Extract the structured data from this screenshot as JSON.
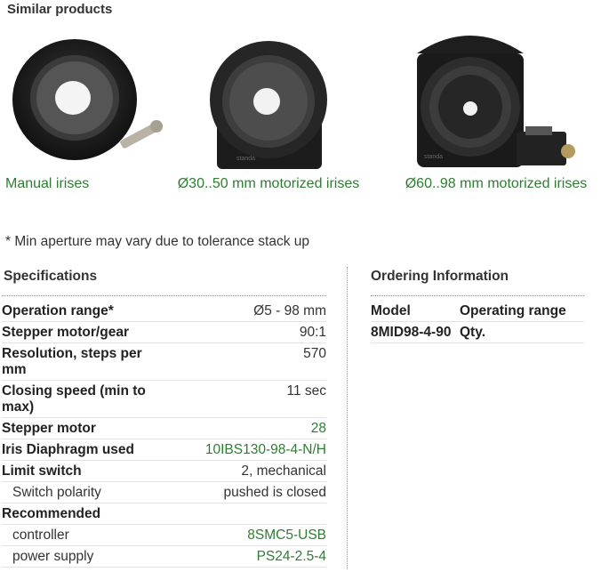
{
  "similar": {
    "title": "Similar products",
    "products": [
      {
        "label": "Manual irises"
      },
      {
        "label": "Ø30..50 mm motorized irises"
      },
      {
        "label": "Ø60..98 mm motorized irises"
      }
    ]
  },
  "note": "* Min aperture may vary due to tolerance stack up",
  "specifications": {
    "heading": "Specifications",
    "rows": [
      {
        "key": "Operation range*",
        "value": "Ø5 - 98 mm"
      },
      {
        "key": "Stepper motor/gear",
        "value": "90:1"
      },
      {
        "key": "Resolution, steps per mm",
        "value": "570"
      },
      {
        "key": "Closing speed (min to max)",
        "value": "11 sec"
      },
      {
        "key": "Stepper motor",
        "value": "28"
      },
      {
        "key": "Iris Diaphragm used",
        "value": "10IBS130-98-4-N/H"
      },
      {
        "key": "Limit switch",
        "value": "2, mechanical"
      },
      {
        "key": "Switch polarity",
        "value": "pushed is closed"
      },
      {
        "key": "Recommended",
        "value": ""
      },
      {
        "key": "controller",
        "value": "8SMC5-USB"
      },
      {
        "key": "power supply",
        "value": "PS24-2.5-4"
      }
    ]
  },
  "ordering": {
    "heading": "Ordering Information",
    "col_model": "Model",
    "col_range": "Operating range",
    "model": "8MID98-4-90",
    "qty": "Qty."
  },
  "colors": {
    "link": "#2e7d32",
    "text": "#222222"
  }
}
